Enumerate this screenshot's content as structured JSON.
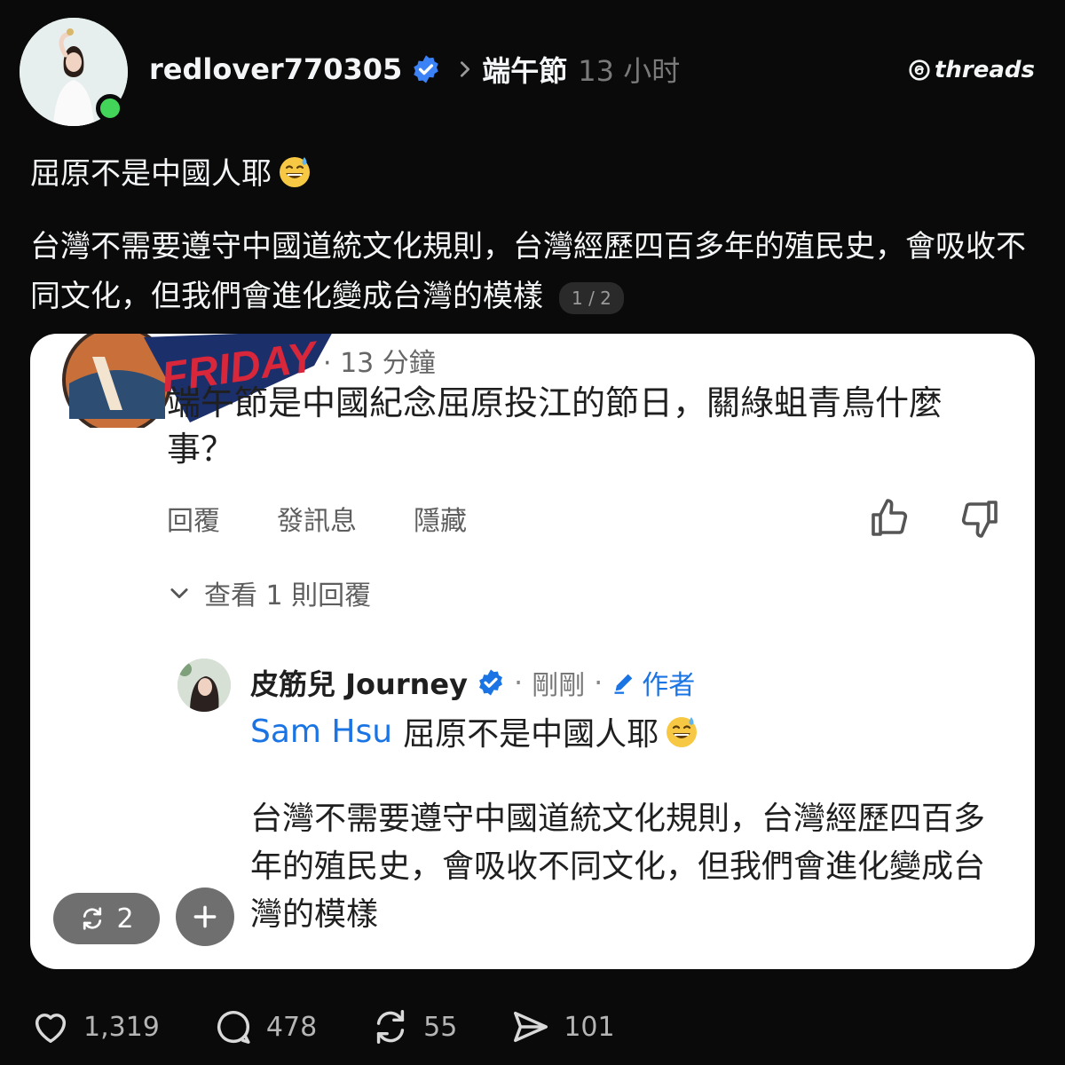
{
  "header": {
    "username": "redlover770305",
    "topic": "端午節",
    "time": "13 小时",
    "brand": "threads"
  },
  "post": {
    "line1": "屈原不是中國人耶",
    "body": "台灣不需要遵守中國道統文化規則，台灣經歷四百多年的殖民史，會吸收不同文化，但我們會進化變成台灣的模樣",
    "pager": "1 / 2"
  },
  "card": {
    "comment_time": "· 13 分鐘",
    "comment_text": "端午節是中國紀念屈原投江的節日，關綠蛆青鳥什麼事？",
    "actions": [
      "回覆",
      "發訊息",
      "隱藏"
    ],
    "view_replies": "查看 1 則回覆",
    "reply": {
      "name": "皮筋兒 Journey",
      "sep": "·",
      "time": "剛剛",
      "author_label": "作者",
      "mention": "Sam Hsu",
      "line1": "屈原不是中國人耶",
      "body": "台灣不需要遵守中國道統文化規則，台灣經歷四百多年的殖民史，會吸收不同文化，但我們會進化變成台灣的模樣"
    },
    "repost_count": "2"
  },
  "stats": {
    "likes": "1,319",
    "comments": "478",
    "reposts": "55",
    "shares": "101"
  },
  "colors": {
    "background": "#0a0a0a",
    "verified": "#3b82f6",
    "online": "#43d55a",
    "link": "#1b74e4"
  },
  "icons": [
    "verified-badge-icon",
    "chevron-right-icon",
    "threads-logo-icon",
    "smiling-sweat-emoji",
    "thumbs-up-icon",
    "thumbs-down-icon",
    "chevron-down-icon",
    "pencil-icon",
    "repost-icon",
    "plus-icon",
    "heart-icon",
    "comment-icon",
    "share-icon"
  ]
}
